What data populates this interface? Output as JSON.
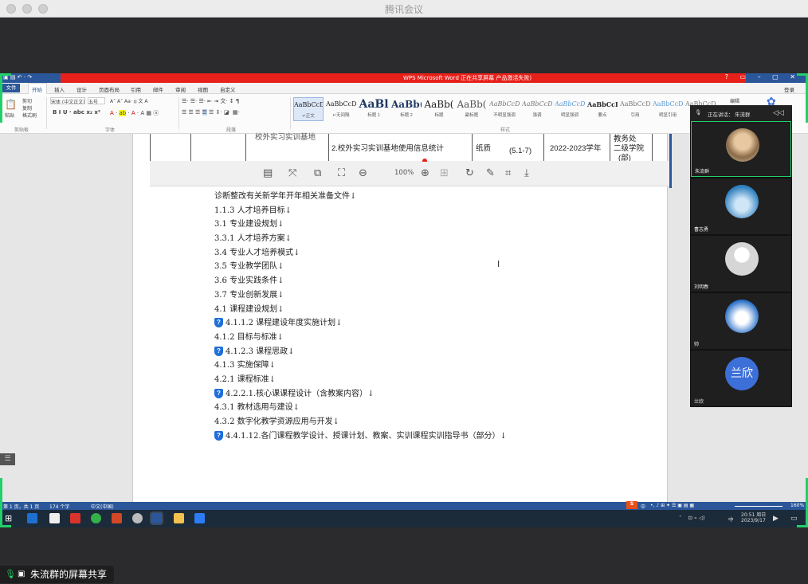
{
  "app_title": "腾讯会议",
  "word": {
    "qa_title": "WPS Microsoft Word  正在共享屏幕  产品激活失败)",
    "tabs": [
      "文件",
      "开始",
      "插入",
      "设计",
      "页面布局",
      "引用",
      "邮件",
      "审阅",
      "视图",
      "自定义"
    ],
    "clipboard": {
      "paste": "粘贴",
      "cut": "剪切",
      "copy": "复制",
      "format_painter": "格式刷",
      "group": "剪贴板"
    },
    "font": {
      "name": "宋体 (中文正文)",
      "size": "五号",
      "group": "字体"
    },
    "paragraph_group": "段落",
    "styles_group": "样式",
    "styles": [
      {
        "sample": "AaBbCcDd",
        "name": "↵正文"
      },
      {
        "sample": "AaBbCcDd",
        "name": "↵无间隔"
      },
      {
        "sample": "AaBl",
        "name": "标题 1"
      },
      {
        "sample": "AaBb(",
        "name": "标题 2"
      },
      {
        "sample": "AaBb(",
        "name": "标题"
      },
      {
        "sample": "AaBb(",
        "name": "副标题"
      },
      {
        "sample": "AaBbCcDd",
        "name": "不明显强调"
      },
      {
        "sample": "AaBbCcDd",
        "name": "强调"
      },
      {
        "sample": "AaBbCcDd",
        "name": "明显强调"
      },
      {
        "sample": "AaBbCcD",
        "name": "要点"
      },
      {
        "sample": "AaBbCcDd",
        "name": "引用"
      },
      {
        "sample": "AaBbCcDd",
        "name": "明显引用"
      },
      {
        "sample": "AaBbCcDd",
        "name": "不明显参考"
      }
    ],
    "right_edit": "编辑",
    "login": "登录"
  },
  "table_row": {
    "col1": "校外实习实训基地",
    "col2": "2.校外实习实训基地使用信息统计",
    "col3": "纸质",
    "col4": "(5.1-7)",
    "col5": "2022-2023学年",
    "col6_l1": "教务处",
    "col6_l2": "二级学院",
    "col6_l3": "(部)"
  },
  "image_toolbar": {
    "zoom": "100%"
  },
  "document_lines": [
    {
      "text": "诊断整改有关新学年开年相关准备文件↓",
      "shield": false
    },
    {
      "text": "1.1.3 人才培养目标↓",
      "shield": false
    },
    {
      "text": "3.1 专业建设规划↓",
      "shield": false
    },
    {
      "text": "3.3.1 人才培养方案↓",
      "shield": false
    },
    {
      "text": "3.4 专业人才培养模式↓",
      "shield": false
    },
    {
      "text": "3.5 专业教学团队↓",
      "shield": false
    },
    {
      "text": "3.6 专业实践条件↓",
      "shield": false
    },
    {
      "text": "3.7 专业创新发展↓",
      "shield": false
    },
    {
      "text": "4.1 课程建设规划↓",
      "shield": false
    },
    {
      "text": "4.1.1.2 课程建设年度实施计划↓",
      "shield": true
    },
    {
      "text": "4.1.2 目标与标准↓",
      "shield": false
    },
    {
      "text": "4.1.2.3 课程思政↓",
      "shield": true
    },
    {
      "text": "4.1.3 实施保障↓",
      "shield": false
    },
    {
      "text": "4.2.1 课程标准↓",
      "shield": false
    },
    {
      "text": "4.2.2.1.核心课课程设计（含教案内容）↓",
      "shield": true
    },
    {
      "text": "4.3.1 教材选用与建设↓",
      "shield": false
    },
    {
      "text": "4.3.2 数字化教学资源应用与开发↓",
      "shield": false
    },
    {
      "text": "4.4.1.12.各门课程教学设计、授课计划、教案、实训课程实训指导书（部分）↓",
      "shield": true
    }
  ],
  "status_bar": {
    "page": "第 1 页，共 1 页",
    "words": "174 个字",
    "lang": "中文(中国)",
    "zoom": "160%",
    "ime": "中"
  },
  "taskbar": {
    "time": "20:51 周日",
    "date": "2023/9/17",
    "ime": "中"
  },
  "video_panel": {
    "speaking_label": "正在讲话：",
    "speaking_name": "朱流群",
    "participants": [
      {
        "name": "朱流群",
        "type": "photo"
      },
      {
        "name": "曹志勇",
        "type": "statue"
      },
      {
        "name": "刘明春",
        "type": "default"
      },
      {
        "name": "帅",
        "type": "sky"
      },
      {
        "name": "兰欣",
        "type": "text",
        "avatar_text": "兰欣"
      }
    ]
  },
  "share_label": "朱流群的屏幕共享",
  "colors": {
    "word_blue": "#2b579a",
    "red": "#e8201a",
    "green": "#22d06a",
    "avatar_blue": "#3c6fd8"
  }
}
